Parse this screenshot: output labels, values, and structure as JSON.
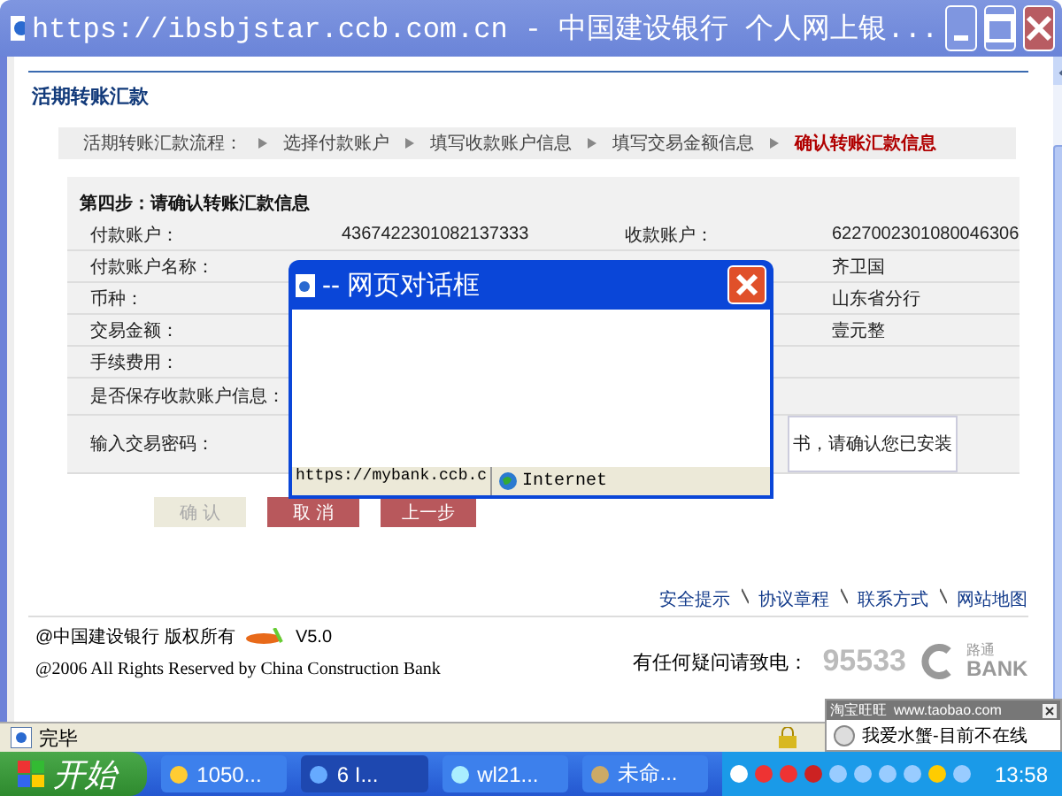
{
  "window": {
    "title": "https://ibsbjstar.ccb.com.cn - 中国建设银行 个人网上银..."
  },
  "page": {
    "heading": "活期转账汇款",
    "breadcrumb": {
      "label": "活期转账汇款流程：",
      "steps": [
        {
          "label": "选择付款账户",
          "selected": false
        },
        {
          "label": "填写收款账户信息",
          "selected": false
        },
        {
          "label": "填写交易金额信息",
          "selected": false
        },
        {
          "label": "确认转账汇款信息",
          "selected": true
        }
      ]
    },
    "form": {
      "title": "第四步：请确认转账汇款信息",
      "rows": [
        {
          "label": "付款账户：",
          "value": "4367422301082137333",
          "right_label": "收款账户：",
          "right_value": "6227002301080046306"
        },
        {
          "label": "付款账户名称：",
          "right_value": "齐卫国"
        },
        {
          "label": "币种：",
          "right_value": "山东省分行"
        },
        {
          "label": "交易金额：",
          "right_value": "壹元整"
        },
        {
          "label": "手续费用："
        },
        {
          "label": "是否保存收款账户信息："
        },
        {
          "label": "输入交易密码：",
          "note": "书，请确认您已安装"
        }
      ]
    },
    "buttons": [
      {
        "label": "确 认",
        "disabled": true
      },
      {
        "label": "取 消",
        "disabled": false
      },
      {
        "label": "上一步",
        "disabled": false
      }
    ],
    "footer_links": [
      "安全提示",
      "协议章程",
      "联系方式",
      "网站地图"
    ],
    "copyright": "@中国建设银行 版权所有",
    "version": "V5.0",
    "copyright_en": "@2006 All Rights Reserved by China Construction Bank",
    "hotline_label": "有任何疑问请致电：",
    "hotline": "95533",
    "logo_top": "路通",
    "logo_bottom": "BANK"
  },
  "status_bar": {
    "text": "完毕"
  },
  "dialog": {
    "title": "-- 网页对话框",
    "url": "https://mybank.ccb.c",
    "zone": "Internet"
  },
  "im_popup": {
    "title": "淘宝旺旺",
    "site": "www.taobao.com",
    "message": "我爱水蟹-目前不在线"
  },
  "taskbar": {
    "start": "开始",
    "tasks": [
      {
        "label": "1050...",
        "selected": false
      },
      {
        "label": "6 I...",
        "selected": true
      },
      {
        "label": "wl21...",
        "selected": false
      },
      {
        "label": "未命...",
        "selected": false
      }
    ],
    "clock": "13:58"
  }
}
